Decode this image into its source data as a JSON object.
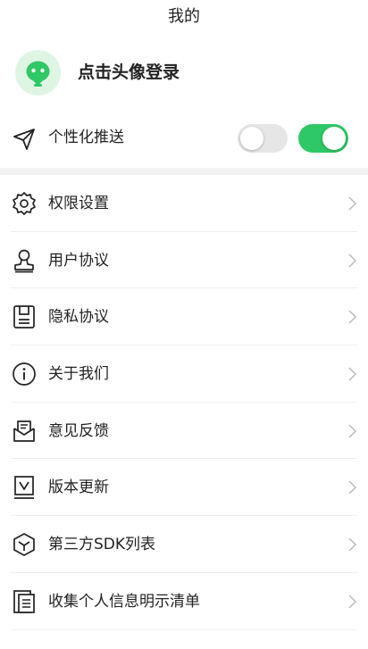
{
  "header": {
    "title": "我的"
  },
  "profile": {
    "login_text": "点击头像登录",
    "avatar_icon": "robot-avatar-icon",
    "accent": "#2ec866"
  },
  "push": {
    "label": "个性化推送",
    "icon": "send-icon",
    "toggles": [
      {
        "state": "off"
      },
      {
        "state": "on"
      }
    ]
  },
  "menu": {
    "items": [
      {
        "label": "权限设置",
        "icon": "gear-icon"
      },
      {
        "label": "用户协议",
        "icon": "user-stamp-icon"
      },
      {
        "label": "隐私协议",
        "icon": "document-icon"
      },
      {
        "label": "关于我们",
        "icon": "info-icon"
      },
      {
        "label": "意见反馈",
        "icon": "feedback-icon"
      },
      {
        "label": "版本更新",
        "icon": "version-icon"
      },
      {
        "label": "第三方SDK列表",
        "icon": "cube-icon"
      },
      {
        "label": "收集个人信息明示清单",
        "icon": "list-document-icon"
      }
    ]
  }
}
